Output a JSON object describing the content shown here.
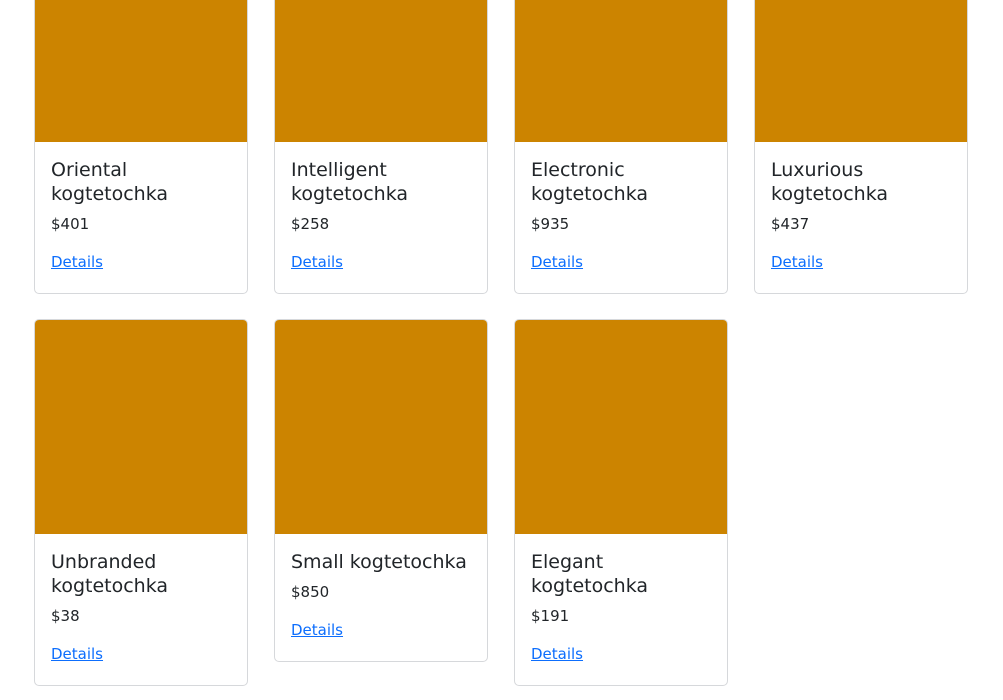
{
  "colors": {
    "image_placeholder": "#cc8400",
    "link": "#0d6efd"
  },
  "products": [
    {
      "title": "Oriental kogtetochka",
      "price": "$401",
      "link": "Details"
    },
    {
      "title": "Intelligent kogtetochka",
      "price": "$258",
      "link": "Details"
    },
    {
      "title": "Electronic kogtetochka",
      "price": "$935",
      "link": "Details"
    },
    {
      "title": "Luxurious kogtetochka",
      "price": "$437",
      "link": "Details"
    },
    {
      "title": "Unbranded kogtetochka",
      "price": "$38",
      "link": "Details"
    },
    {
      "title": "Small kogtetochka",
      "price": "$850",
      "link": "Details"
    },
    {
      "title": "Elegant kogtetochka",
      "price": "$191",
      "link": "Details"
    }
  ]
}
